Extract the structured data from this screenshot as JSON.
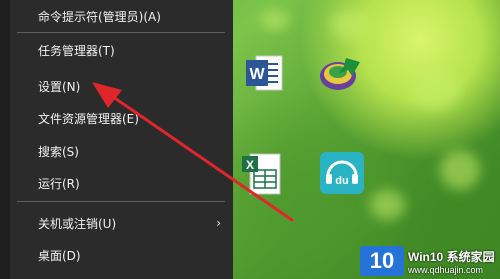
{
  "menu": {
    "items": [
      {
        "label": "命令提示符(管理员)(A)"
      },
      {
        "label": "任务管理器(T)"
      },
      {
        "label": "设置(N)"
      },
      {
        "label": "文件资源管理器(E)"
      },
      {
        "label": "搜索(S)"
      },
      {
        "label": "运行(R)"
      },
      {
        "label": "关机或注销(U)",
        "submenu_icon": "chevron-right-icon"
      },
      {
        "label": "桌面(D)"
      }
    ]
  },
  "desktop": {
    "icons": [
      {
        "name": "word-icon",
        "text": "W"
      },
      {
        "name": "download-manager-icon"
      },
      {
        "name": "excel-icon",
        "text": "X"
      },
      {
        "name": "music-app-icon",
        "text": "du"
      }
    ]
  },
  "watermark": {
    "brand": "10",
    "title": "Win10 系统家园",
    "url": "www.qdhuajin.com"
  },
  "colors": {
    "menu_bg": "#2b2b2b",
    "arrow": "#e0262b",
    "word_blue": "#2b5797",
    "excel_green": "#1e7145",
    "music_teal": "#2ab3c5"
  }
}
